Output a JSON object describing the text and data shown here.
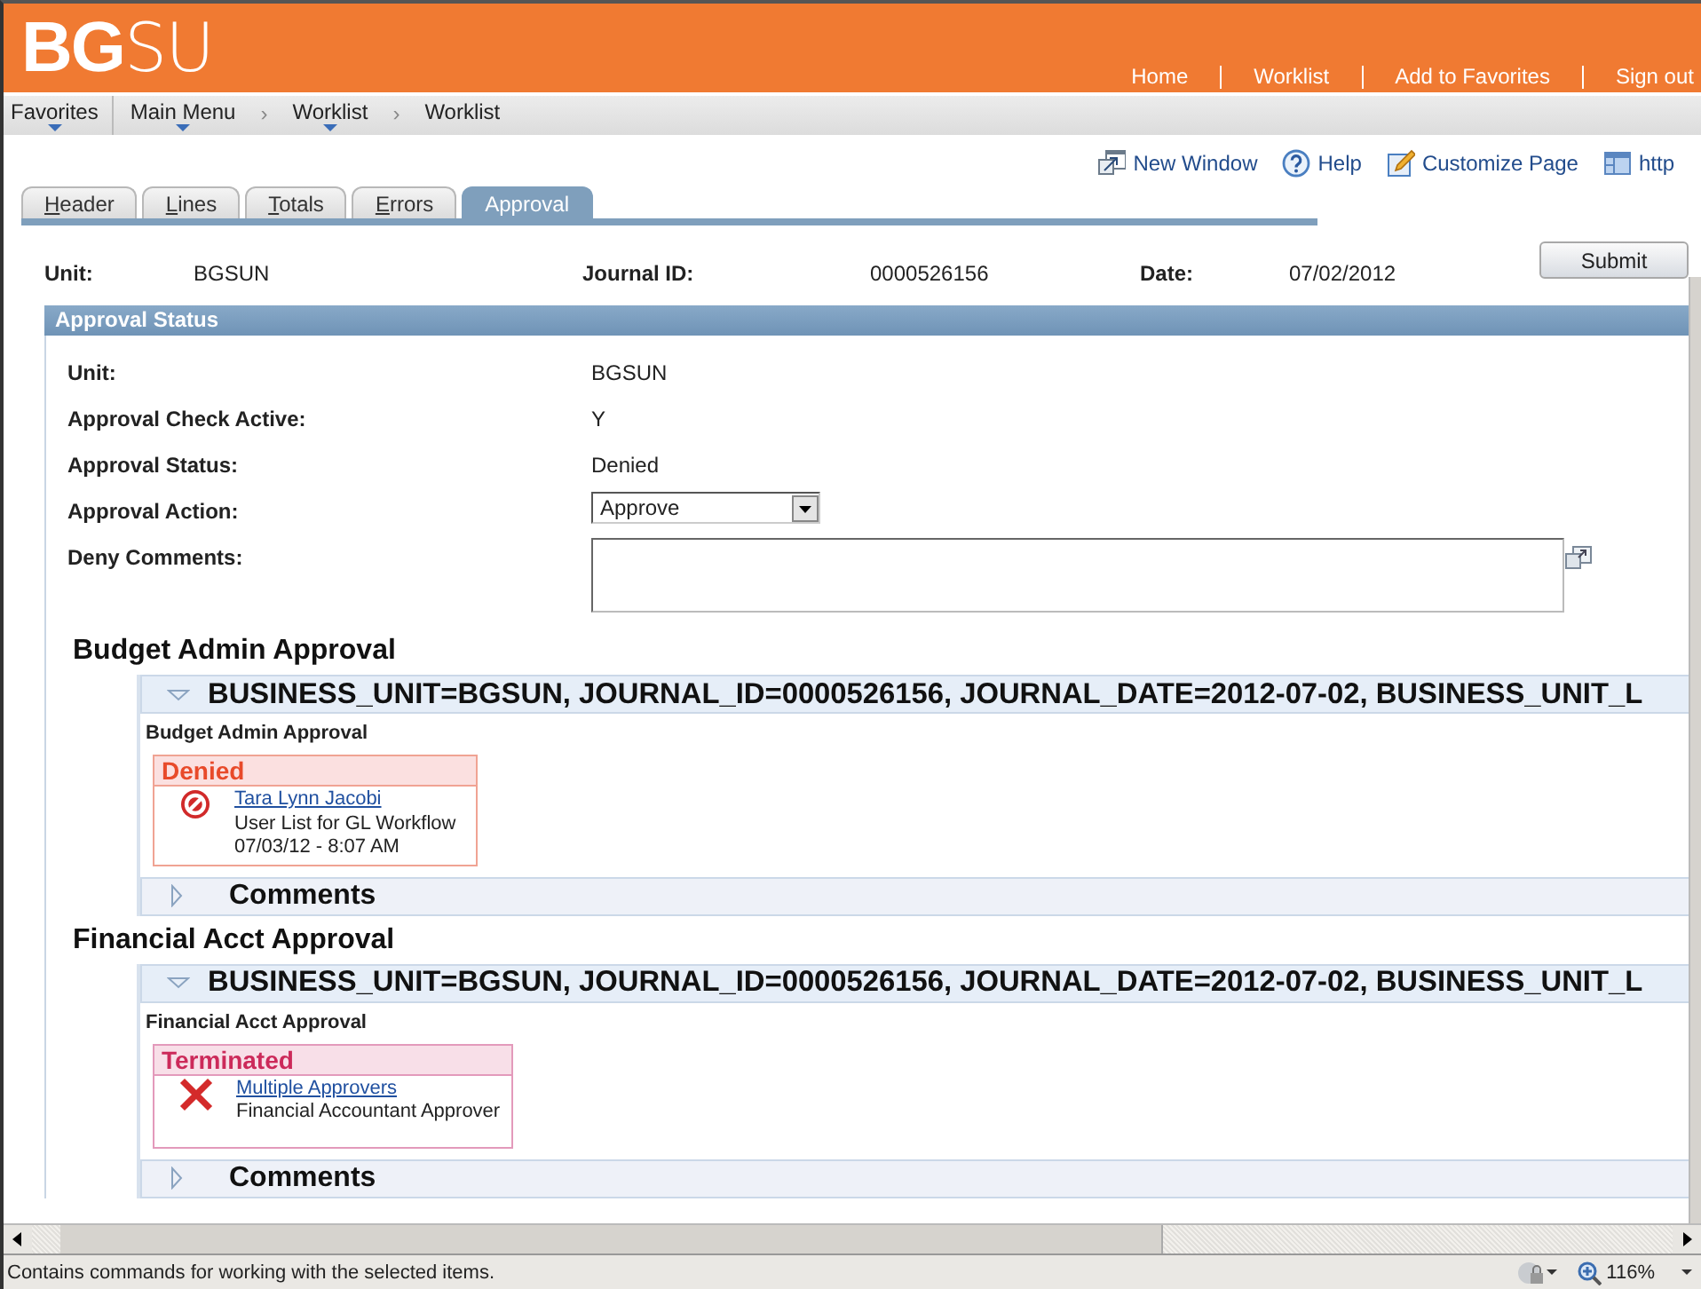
{
  "header": {
    "logo_bold": "BG",
    "logo_light": "SU",
    "links": [
      "Home",
      "Worklist",
      "Add to Favorites",
      "Sign out"
    ]
  },
  "breadcrumbs": {
    "favorites": "Favorites",
    "separator": "›",
    "path": [
      {
        "label": "Main Menu",
        "menu": true
      },
      {
        "label": "Worklist",
        "menu": true
      },
      {
        "label": "Worklist",
        "menu": false
      }
    ]
  },
  "toolbar": [
    {
      "kind": "new-window",
      "label": "New Window"
    },
    {
      "kind": "help",
      "label": "Help"
    },
    {
      "kind": "customize",
      "label": "Customize Page"
    },
    {
      "kind": "url",
      "label": "http"
    }
  ],
  "tabs": [
    {
      "label": "Header",
      "selected": false
    },
    {
      "label": "Lines",
      "selected": false
    },
    {
      "label": "Totals",
      "selected": false
    },
    {
      "label": "Errors",
      "selected": false
    },
    {
      "label": "Approval",
      "selected": true
    }
  ],
  "summary": [
    {
      "label": "Unit:",
      "value": "BGSUN"
    },
    {
      "label": "Journal ID:",
      "value": "0000526156"
    },
    {
      "label": "Date:",
      "value": "07/02/2012"
    }
  ],
  "submit_button": "Submit",
  "approval_status": {
    "title": "Approval Status",
    "fields": [
      {
        "kind": "text",
        "label": "Unit:",
        "value": "BGSUN"
      },
      {
        "kind": "text",
        "label": "Approval Check Active:",
        "value": "Y"
      },
      {
        "kind": "text",
        "label": "Approval Status:",
        "value": "Denied"
      },
      {
        "kind": "select",
        "label": "Approval Action:",
        "value": "Approve"
      },
      {
        "kind": "textarea",
        "label": "Deny Comments:"
      }
    ]
  },
  "stages": [
    {
      "title": "Budget Admin Approval",
      "key": "BUSINESS_UNIT=BGSUN, JOURNAL_ID=0000526156, JOURNAL_DATE=2012-07-02, BUSINESS_UNIT_L",
      "expanded": true,
      "subtitle": "Budget Admin Approval",
      "status": {
        "kind": "denied",
        "label": "Denied",
        "link": "Tara Lynn Jacobi",
        "lines": [
          "User List for GL Workflow",
          "07/03/12 - 8:07 AM"
        ]
      },
      "comments": {
        "label": "Comments",
        "expanded": false
      }
    },
    {
      "title": "Financial Acct Approval",
      "key": "BUSINESS_UNIT=BGSUN, JOURNAL_ID=0000526156, JOURNAL_DATE=2012-07-02, BUSINESS_UNIT_L",
      "expanded": true,
      "subtitle": "Financial Acct Approval",
      "status": {
        "kind": "terminated",
        "label": "Terminated",
        "link": "Multiple Approvers",
        "lines": [
          "Financial Accountant Approver"
        ]
      },
      "comments": {
        "label": "Comments",
        "expanded": false
      }
    }
  ],
  "status_bar": {
    "text": "Contains commands for working with the selected items.",
    "zoom": "116%"
  }
}
